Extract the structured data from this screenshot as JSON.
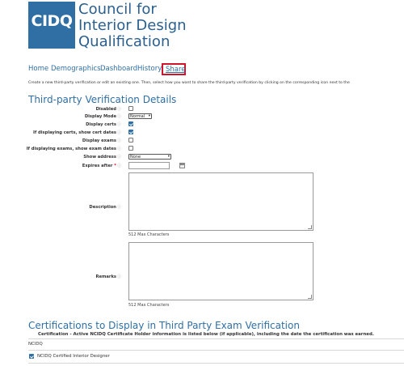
{
  "brand": {
    "logo_text": "CIDQ",
    "org_name_lines": [
      "Council for",
      "Interior Design",
      "Qualification"
    ],
    "logo_color": "#2f6fa4"
  },
  "nav": {
    "items": [
      {
        "label": "Home"
      },
      {
        "label": "Demographics"
      },
      {
        "label": "Dashboard"
      },
      {
        "label": "History"
      }
    ],
    "active": {
      "label": "Share"
    },
    "highlight_color": "#d0142c"
  },
  "intro": "Create a new third-party verification or edit an existing one. Then, select how you want to share the third-party verification by clicking on the corresponding icon next to the",
  "form": {
    "title": "Third-party Verification Details",
    "fields": {
      "disabled": {
        "label": "Disabled",
        "checked": false
      },
      "display_mode": {
        "label": "Display Mode",
        "value": "Normal"
      },
      "display_certs": {
        "label": "Display certs",
        "checked": true
      },
      "show_cert_dates": {
        "label": "If displaying certs, show cert dates",
        "checked": true
      },
      "display_exams": {
        "label": "Display exams",
        "checked": false
      },
      "show_exam_dates": {
        "label": "If displaying exams, show exam dates",
        "checked": false
      },
      "show_address": {
        "label": "Show address",
        "value": "None"
      },
      "expires_after": {
        "label": "Expires after",
        "required_mark": "*",
        "value": ""
      },
      "description": {
        "label": "Description",
        "value": "",
        "hint": "512 Max Characters"
      },
      "remarks": {
        "label": "Remarks",
        "value": "",
        "hint": "512 Max Characters"
      }
    }
  },
  "certifications": {
    "title": "Certifications to Display in Third Party Exam Verification",
    "header": "Certification - Active NCIDQ Certificate Holder information is listed below (if applicable), including the date the certification was earned.",
    "group": "NCIDQ",
    "items": [
      {
        "label": "NCIDQ Certified Interior Designer",
        "checked": true
      }
    ]
  }
}
